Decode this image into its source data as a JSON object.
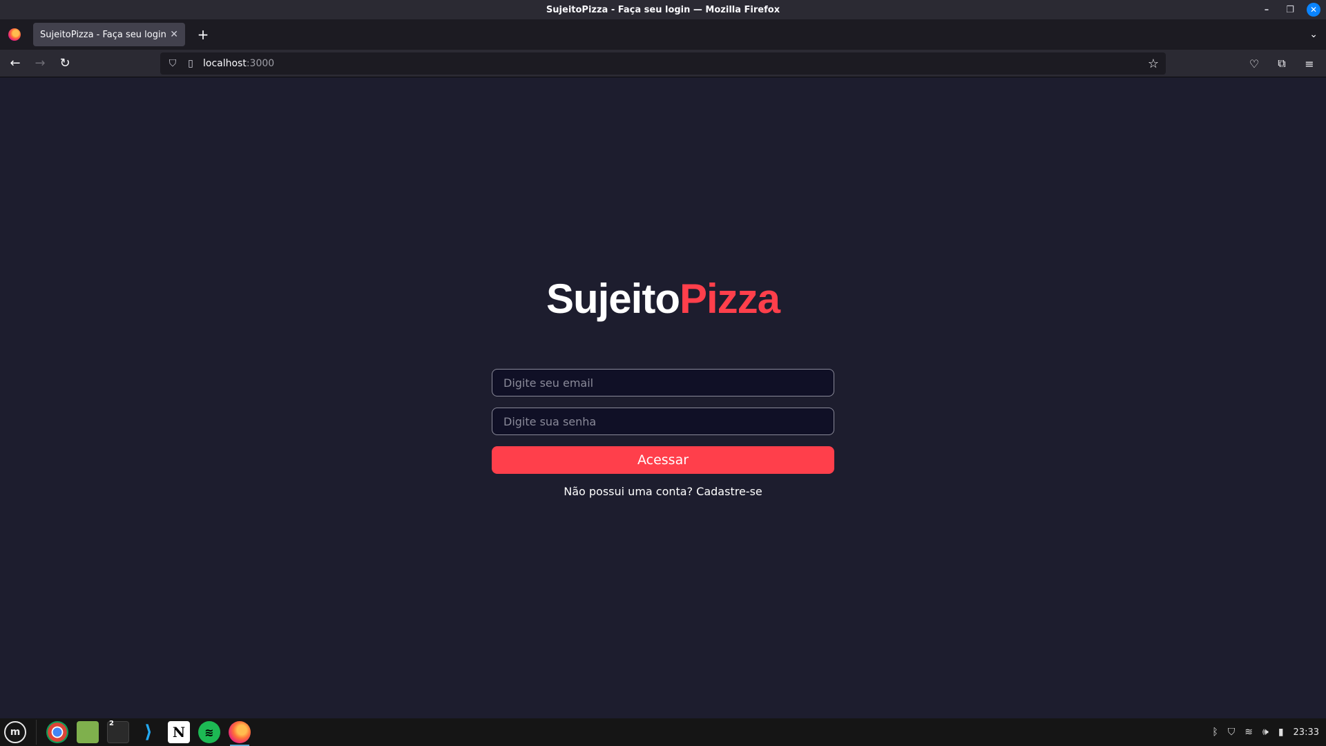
{
  "window": {
    "title": "SujeitoPizza - Faça seu login — Mozilla Firefox"
  },
  "tabs": [
    {
      "title": "SujeitoPizza - Faça seu login"
    }
  ],
  "url": {
    "host": "localhost",
    "port": ":3000"
  },
  "page": {
    "logo_white": "Sujeito",
    "logo_red": "Pizza",
    "email_placeholder": "Digite seu email",
    "password_placeholder": "Digite sua senha",
    "submit_label": "Acessar",
    "signup_text": "Não possui uma conta? Cadastre-se"
  },
  "taskbar": {
    "terminal_badge": "2",
    "clock": "23:33"
  },
  "colors": {
    "background": "#1d1d2e",
    "accent": "#ff3f4b",
    "input_bg": "#101026"
  }
}
